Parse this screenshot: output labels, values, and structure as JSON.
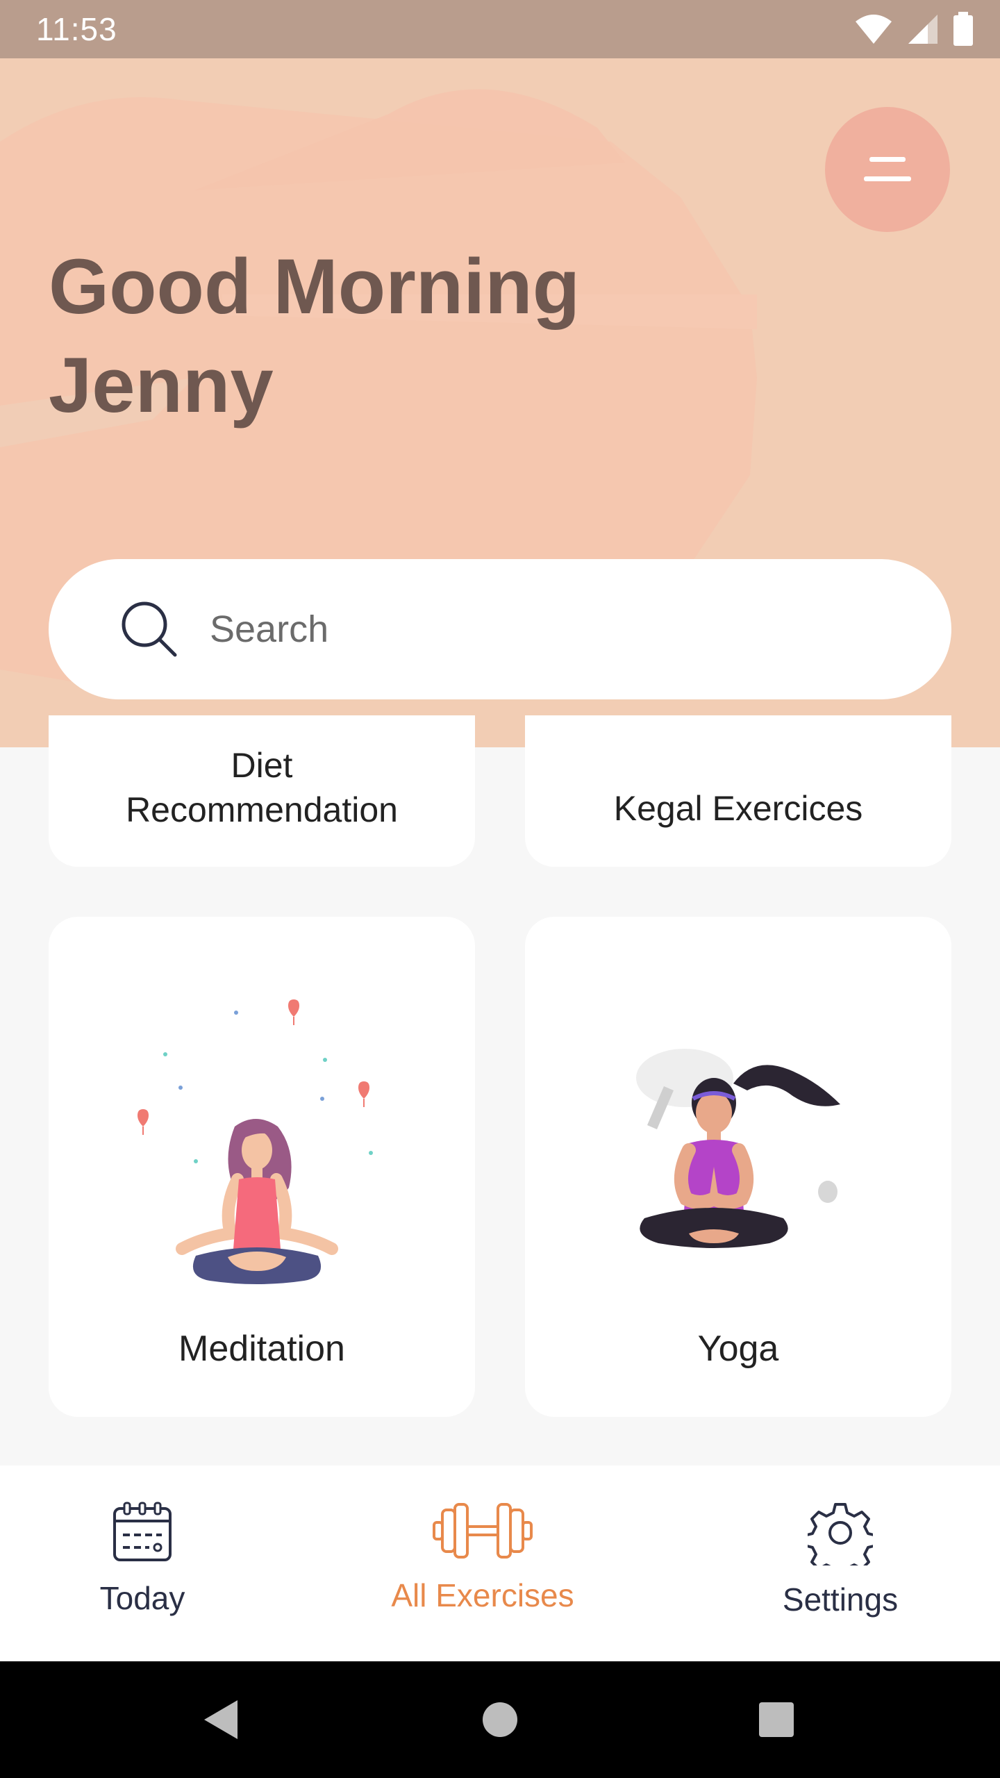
{
  "status_bar": {
    "time": "11:53"
  },
  "header": {
    "greeting_line1": "Good Morning",
    "greeting_line2": "Jenny"
  },
  "search": {
    "placeholder": "Search"
  },
  "cards": [
    {
      "line1": "Diet",
      "line2": "Recommendation"
    },
    {
      "label": "Kegal Exercices"
    },
    {
      "label": "Meditation",
      "illustration": "meditation-illustration"
    },
    {
      "label": "Yoga",
      "illustration": "yoga-illustration"
    }
  ],
  "bottom_nav": {
    "items": [
      {
        "label": "Today",
        "icon": "calendar-icon"
      },
      {
        "label": "All Exercises",
        "icon": "dumbbell-icon"
      },
      {
        "label": "Settings",
        "icon": "gear-icon"
      }
    ],
    "active": "All Exercises"
  },
  "colors": {
    "header_bg": "#f2cdb4",
    "menu_button": "#f0b09e",
    "greeting": "#6f5850",
    "accent": "#e8894b",
    "nav_text": "#2a2f45"
  }
}
